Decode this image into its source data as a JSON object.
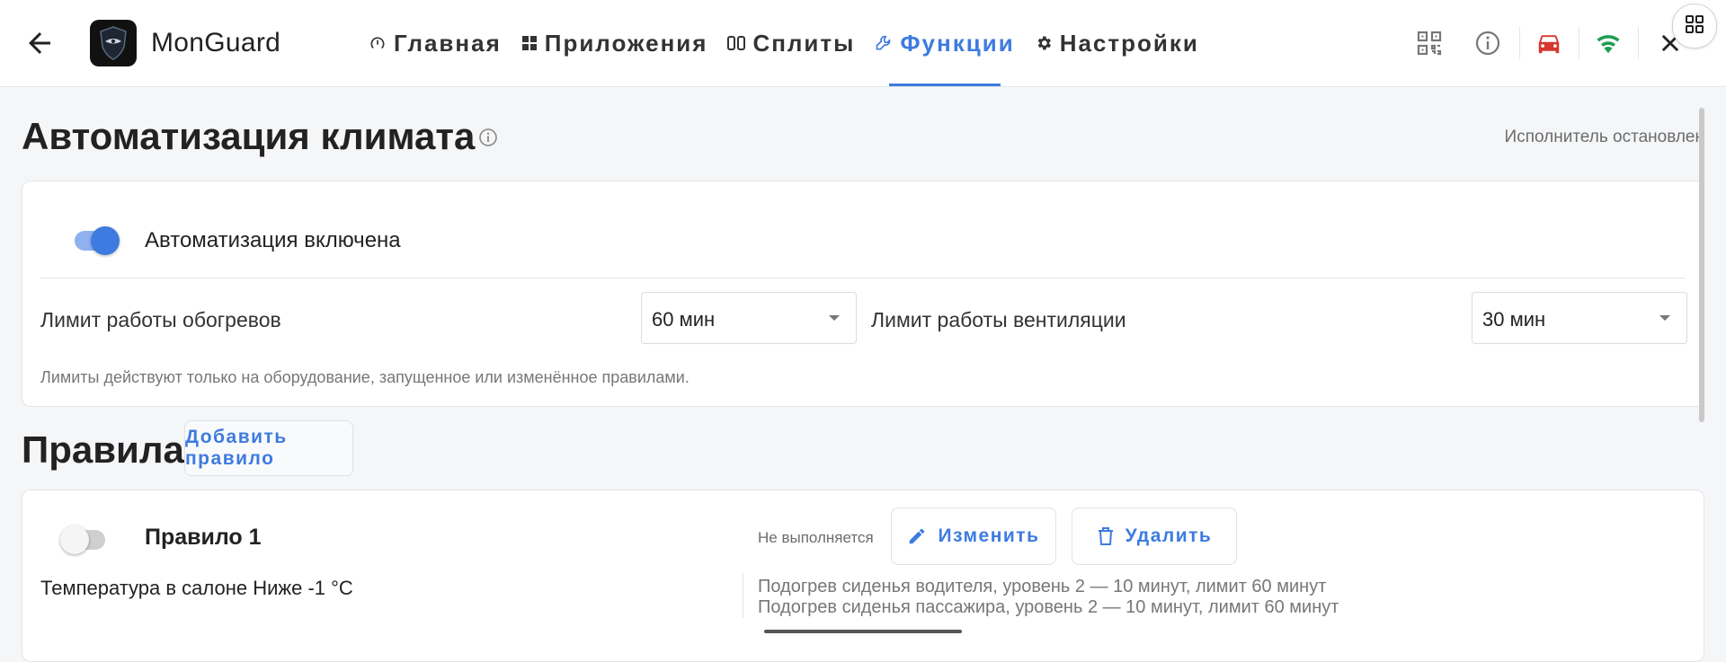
{
  "header": {
    "app_name": "MonGuard",
    "nav": [
      {
        "label": "Главная",
        "icon": "gauge-icon",
        "active": false
      },
      {
        "label": "Приложения",
        "icon": "grid-icon",
        "active": false
      },
      {
        "label": "Сплиты",
        "icon": "split-icon",
        "active": false
      },
      {
        "label": "Функции",
        "icon": "wrench-icon",
        "active": true
      },
      {
        "label": "Настройки",
        "icon": "gear-icon",
        "active": false
      }
    ],
    "icons": [
      "qr-code-icon",
      "info-icon",
      "car-icon",
      "wifi-icon",
      "close-icon",
      "apps-grid-icon"
    ],
    "colors": {
      "accent": "#3d7be0",
      "car": "#d8362f",
      "wifi": "#1e9e52"
    }
  },
  "page": {
    "title": "Автоматизация климата",
    "status": "Исполнитель остановлен"
  },
  "automation": {
    "enabled": true,
    "label": "Автоматизация включена",
    "heating_limit_label": "Лимит работы обогревов",
    "heating_limit_value": "60 мин",
    "ventilation_limit_label": "Лимит работы вентиляции",
    "ventilation_limit_value": "30 мин",
    "hint": "Лимиты действуют только на оборудование, запущенное или изменённое правилами."
  },
  "rules": {
    "title": "Правила",
    "add_label": "Добавить правило",
    "items": [
      {
        "enabled": false,
        "name": "Правило 1",
        "status": "Не выполняется",
        "edit_label": "Изменить",
        "delete_label": "Удалить",
        "condition": "Температура в салоне Ниже -1 °C",
        "actions": [
          "Подогрев сиденья водителя, уровень 2 — 10 минут, лимит 60 минут",
          "Подогрев сиденья пассажира, уровень 2 — 10 минут, лимит 60 минут"
        ]
      }
    ]
  }
}
